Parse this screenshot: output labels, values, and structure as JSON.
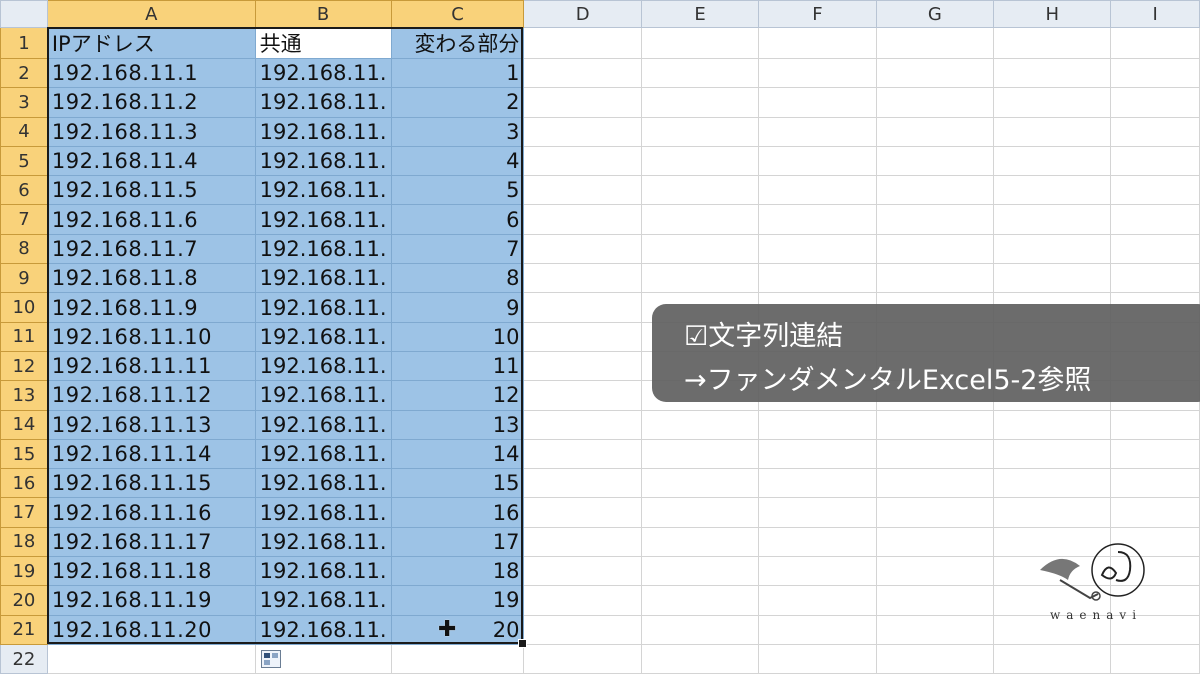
{
  "columns": [
    "A",
    "B",
    "C",
    "D",
    "E",
    "F",
    "G",
    "H",
    "I"
  ],
  "header_row": [
    "IPアドレス",
    "共通",
    "変わる部分"
  ],
  "rows": [
    [
      "192.168.11.1",
      "192.168.11.",
      "1"
    ],
    [
      "192.168.11.2",
      "192.168.11.",
      "2"
    ],
    [
      "192.168.11.3",
      "192.168.11.",
      "3"
    ],
    [
      "192.168.11.4",
      "192.168.11.",
      "4"
    ],
    [
      "192.168.11.5",
      "192.168.11.",
      "5"
    ],
    [
      "192.168.11.6",
      "192.168.11.",
      "6"
    ],
    [
      "192.168.11.7",
      "192.168.11.",
      "7"
    ],
    [
      "192.168.11.8",
      "192.168.11.",
      "8"
    ],
    [
      "192.168.11.9",
      "192.168.11.",
      "9"
    ],
    [
      "192.168.11.10",
      "192.168.11.",
      "10"
    ],
    [
      "192.168.11.11",
      "192.168.11.",
      "11"
    ],
    [
      "192.168.11.12",
      "192.168.11.",
      "12"
    ],
    [
      "192.168.11.13",
      "192.168.11.",
      "13"
    ],
    [
      "192.168.11.14",
      "192.168.11.",
      "14"
    ],
    [
      "192.168.11.15",
      "192.168.11.",
      "15"
    ],
    [
      "192.168.11.16",
      "192.168.11.",
      "16"
    ],
    [
      "192.168.11.17",
      "192.168.11.",
      "17"
    ],
    [
      "192.168.11.18",
      "192.168.11.",
      "18"
    ],
    [
      "192.168.11.19",
      "192.168.11.",
      "19"
    ],
    [
      "192.168.11.20",
      "192.168.11.",
      "20"
    ]
  ],
  "row_numbers": [
    "1",
    "2",
    "3",
    "4",
    "5",
    "6",
    "7",
    "8",
    "9",
    "10",
    "11",
    "12",
    "13",
    "14",
    "15",
    "16",
    "17",
    "18",
    "19",
    "20",
    "21",
    "22"
  ],
  "selection": {
    "range": "A1:C21",
    "active_cell": "B1"
  },
  "colors": {
    "selection_fill": "#9dc3e6",
    "header_selected": "#f9d27a",
    "header_normal": "#e6ecf3"
  },
  "callout": {
    "line1": "☑文字列連結",
    "line2": "→ファンダメンタルExcel5-2参照"
  },
  "logo": {
    "text": "waenavi",
    "icon": "bird-key-emblem"
  },
  "icons": {
    "cursor": "cross-cursor-icon",
    "autofill": "autofill-options-icon"
  }
}
